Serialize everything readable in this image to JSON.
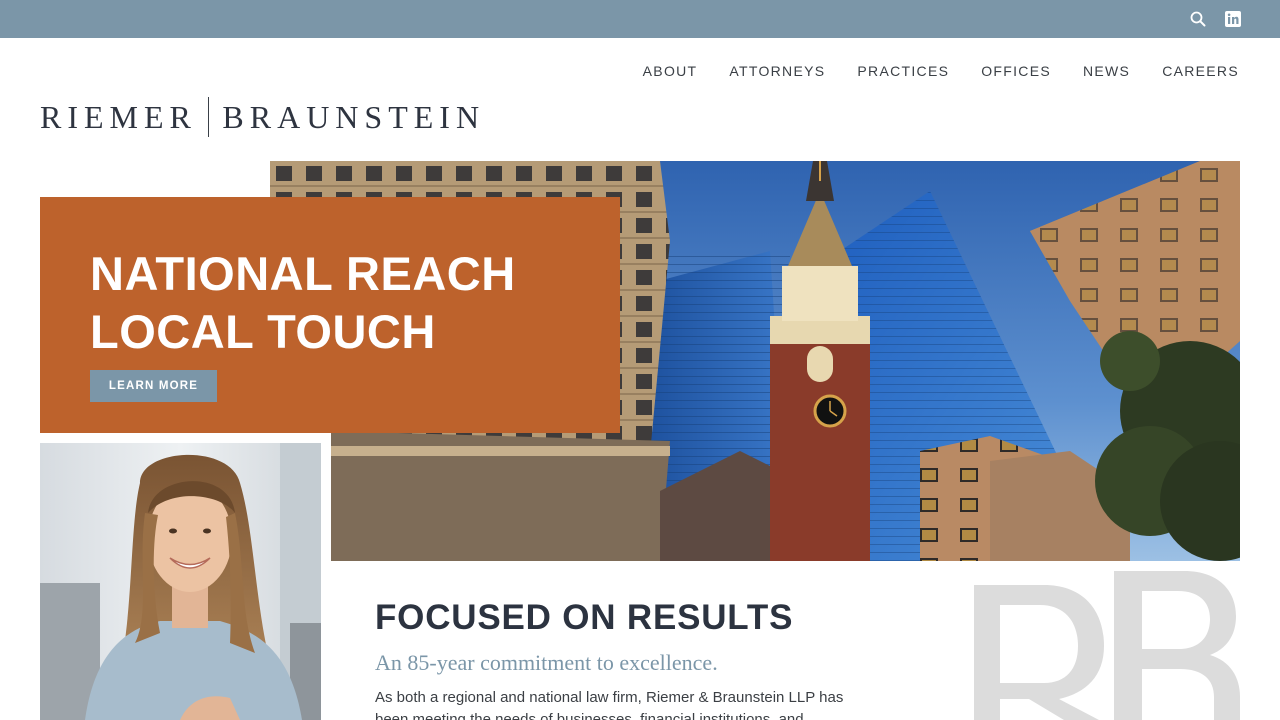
{
  "utility_bar": {
    "bg_color": "#7b96a8",
    "icons": [
      "search-icon",
      "linkedin-icon"
    ]
  },
  "nav": {
    "items": [
      "ABOUT",
      "ATTORNEYS",
      "PRACTICES",
      "OFFICES",
      "NEWS",
      "CAREERS"
    ]
  },
  "logo": {
    "left_word": "RIEMER",
    "right_word": "BRAUNSTEIN"
  },
  "hero": {
    "title_line1": "NATIONAL REACH",
    "title_line2": "LOCAL TOUCH",
    "cta_label": "LEARN MORE",
    "card_color": "#bd622c",
    "cta_color": "#7b96a8"
  },
  "intro": {
    "heading": "FOCUSED ON RESULTS",
    "subheading": "An 85-year commitment to excellence.",
    "body": "As both a regional and national law firm, Riemer & Braunstein LLP has been meeting the needs of businesses, financial institutions, and"
  }
}
